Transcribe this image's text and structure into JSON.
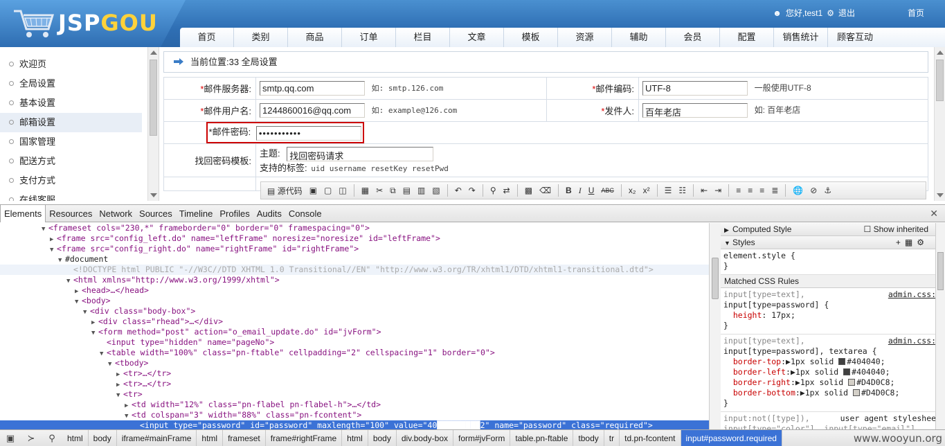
{
  "header": {
    "logo_prefix": "JSP",
    "logo_suffix": "GOU",
    "greeting": "您好,test1",
    "logout": "退出",
    "home": "首页",
    "nav": [
      "首页",
      "类别",
      "商品",
      "订单",
      "栏目",
      "文章",
      "模板",
      "资源",
      "辅助",
      "会员",
      "配置",
      "销售统计",
      "顾客互动"
    ]
  },
  "sidebar": {
    "items": [
      "欢迎页",
      "全局设置",
      "基本设置",
      "邮箱设置",
      "国家管理",
      "配送方式",
      "支付方式",
      "在线客服"
    ],
    "active": "邮箱设置"
  },
  "content": {
    "breadcrumb": "当前位置:33 全局设置",
    "mail_server_label": "邮件服务器:",
    "mail_server_value": "smtp.qq.com",
    "mail_server_hint": "如: smtp.126.com",
    "mail_encoding_label": "邮件编码:",
    "mail_encoding_value": "UTF-8",
    "mail_encoding_hint": "一般使用UTF-8",
    "mail_user_label": "邮件用户名:",
    "mail_user_value": "1244860016@qq.com",
    "mail_user_hint": "如: example@126.com",
    "sender_label": "发件人:",
    "sender_value": "百年老店",
    "sender_hint": "如: 百年老店",
    "mail_password_label": "邮件密码:",
    "mail_password_value": "•••••••••••",
    "required_mark": "*",
    "retrieve_tpl_label": "找回密码模板:",
    "subject_label": "主题:",
    "subject_value": "找回密码请求",
    "tags_label": "支持的标签:",
    "tags_value": "uid username resetKey resetPwd",
    "source_btn": "源代码",
    "toolbar_bold": "B",
    "toolbar_italic": "I",
    "toolbar_underline": "U",
    "toolbar_strike": "ABC",
    "toolbar_sub": "x₂",
    "toolbar_sup": "x²"
  },
  "devtools": {
    "tabs": [
      "Elements",
      "Resources",
      "Network",
      "Sources",
      "Timeline",
      "Profiles",
      "Audits",
      "Console"
    ],
    "active_tab": "Elements",
    "dom_lines": [
      {
        "indent": 5,
        "tri": "▼",
        "text": "<frameset cols=\"230,*\" frameborder=\"0\" border=\"0\" framespacing=\"0\">",
        "kind": "tag"
      },
      {
        "indent": 6,
        "tri": "▶",
        "text": "<frame src=\"config_left.do\" name=\"leftFrame\" noresize=\"noresize\" id=\"leftFrame\">",
        "kind": "tag"
      },
      {
        "indent": 6,
        "tri": "▼",
        "text": "<frame src=\"config_right.do\" name=\"rightFrame\" id=\"rightFrame\">",
        "kind": "tag"
      },
      {
        "indent": 7,
        "tri": "▼",
        "text": "#document",
        "kind": "plain"
      },
      {
        "indent": 8,
        "tri": "",
        "text": "<!DOCTYPE html PUBLIC \"-//W3C//DTD XHTML 1.0 Transitional//EN\" \"http://www.w3.org/TR/xhtml1/DTD/xhtml1-transitional.dtd\">",
        "kind": "doctype"
      },
      {
        "indent": 8,
        "tri": "▼",
        "text": "<html xmlns=\"http://www.w3.org/1999/xhtml\">",
        "kind": "tag"
      },
      {
        "indent": 9,
        "tri": "▶",
        "text": "<head>…</head>",
        "kind": "tag"
      },
      {
        "indent": 9,
        "tri": "▼",
        "text": "<body>",
        "kind": "tag"
      },
      {
        "indent": 10,
        "tri": "▼",
        "text": "<div class=\"body-box\">",
        "kind": "tag"
      },
      {
        "indent": 11,
        "tri": "▶",
        "text": "<div class=\"rhead\">…</div>",
        "kind": "tag"
      },
      {
        "indent": 11,
        "tri": "▼",
        "text": "<form method=\"post\" action=\"o_email_update.do\" id=\"jvForm\">",
        "kind": "tag"
      },
      {
        "indent": 12,
        "tri": "",
        "text": "<input type=\"hidden\" name=\"pageNo\">",
        "kind": "tag"
      },
      {
        "indent": 12,
        "tri": "▼",
        "text": "<table width=\"100%\" class=\"pn-ftable\" cellpadding=\"2\" cellspacing=\"1\" border=\"0\">",
        "kind": "tag"
      },
      {
        "indent": 13,
        "tri": "▼",
        "text": "<tbody>",
        "kind": "tag"
      },
      {
        "indent": 14,
        "tri": "▶",
        "text": "<tr>…</tr>",
        "kind": "tag"
      },
      {
        "indent": 14,
        "tri": "▶",
        "text": "<tr>…</tr>",
        "kind": "tag"
      },
      {
        "indent": 14,
        "tri": "▼",
        "text": "<tr>",
        "kind": "tag"
      },
      {
        "indent": 15,
        "tri": "▶",
        "text": "<td width=\"12%\" class=\"pn-flabel pn-flabel-h\">…</td>",
        "kind": "tag"
      },
      {
        "indent": 15,
        "tri": "▼",
        "text": "<td colspan=\"3\" width=\"88%\" class=\"pn-fcontent\">",
        "kind": "tag"
      },
      {
        "indent": 16,
        "tri": "",
        "text": "<input type=\"password\" id=\"password\" maxlength=\"100\" value=\"40█████████2\" name=\"password\" class=\"required\">",
        "kind": "selected"
      }
    ],
    "styles": {
      "computed_style": "Computed Style",
      "show_inherited": "Show inherited",
      "styles_title": "Styles",
      "element_style": "element.style {",
      "close_brace": "}",
      "matched_rules": "Matched CSS Rules",
      "rule1_sel1": "input[type=text],",
      "rule1_sel2": "input[type=password] {",
      "rule1_src": "admin.css:6",
      "rule1_prop": "height",
      "rule1_val": "17px;",
      "rule2_sel1": "input[type=text],",
      "rule2_sel2": "input[type=password], textarea {",
      "rule2_src": "admin.css:4",
      "rule2_props": [
        {
          "prop": "border-top",
          "val": "1px solid",
          "color": "#404040",
          "color_text": "#404040;"
        },
        {
          "prop": "border-left",
          "val": "1px solid",
          "color": "#404040",
          "color_text": "#404040;"
        },
        {
          "prop": "border-right",
          "val": "1px solid",
          "color": "#D4D0C8",
          "color_text": "#D4D0C8;"
        },
        {
          "prop": "border-bottom",
          "val": "1px solid",
          "color": "#D4D0C8",
          "color_text": "#D4D0C8;"
        }
      ],
      "ua_sel": "input:not([type]),",
      "ua_src": "user agent stylesheet",
      "ua_sel2": "input[type=\"color\"], input[type=\"email\"],"
    },
    "breadcrumbs": [
      "html",
      "body",
      "iframe#mainFrame",
      "html",
      "frameset",
      "frame#rightFrame",
      "html",
      "body",
      "div.body-box",
      "form#jvForm",
      "table.pn-ftable",
      "tbody",
      "tr",
      "td.pn-fcontent",
      "input#password.required"
    ],
    "watermark": "www.wooyun.org"
  }
}
